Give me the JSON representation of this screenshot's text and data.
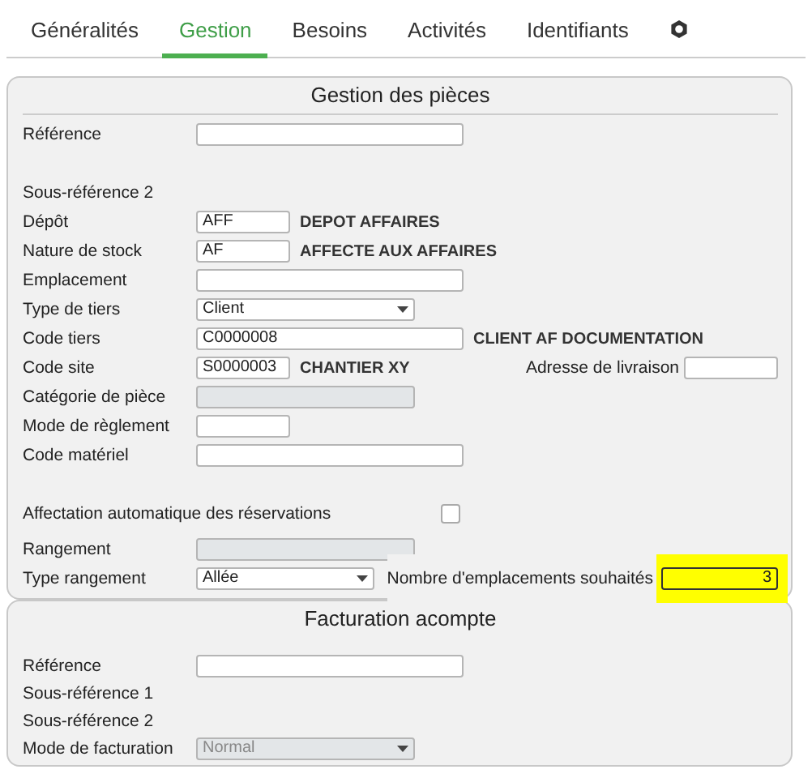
{
  "tabs": [
    {
      "label": "Généralités",
      "selected": false
    },
    {
      "label": "Gestion",
      "selected": true
    },
    {
      "label": "Besoins",
      "selected": false
    },
    {
      "label": "Activités",
      "selected": false
    },
    {
      "label": "Identifiants",
      "selected": false
    }
  ],
  "sections": [
    {
      "title": "Gestion des pièces",
      "groups": [
        [
          {
            "label": "Référence",
            "field": {
              "kind": "text",
              "disabled": false
            }
          }
        ],
        [
          {
            "label": "Sous-référence 2"
          },
          {
            "label": "Dépôt",
            "field": {
              "kind": "code",
              "value": "AFF",
              "disabled": false
            },
            "note": "DEPOT AFFAIRES"
          },
          {
            "label": "Nature de stock",
            "field": {
              "kind": "code",
              "value": "AF",
              "disabled": false
            },
            "note": "AFFECTE AUX AFFAIRES"
          },
          {
            "label": "Emplacement",
            "field": {
              "kind": "text",
              "disabled": false
            }
          },
          {
            "label": "Type de tiers",
            "field": {
              "kind": "select",
              "value": "Client",
              "disabled": false
            }
          },
          {
            "label": "Code tiers",
            "field": {
              "kind": "text",
              "value": "C0000008",
              "disabled": false
            },
            "note": "CLIENT AF  DOCUMENTATION"
          },
          {
            "label": "Code site",
            "field": {
              "kind": "code",
              "value": "S0000003",
              "disabled": false
            },
            "note": "CHANTIER XY",
            "aside": {
              "label": "Adresse de livraison",
              "field": {
                "kind": "code",
                "disabled": false,
                "highlighted": false
              }
            }
          },
          {
            "label": "Catégorie de pièce",
            "field": {
              "kind": "locked",
              "disabled": true
            }
          },
          {
            "label": "Mode de règlement",
            "field": {
              "kind": "code",
              "disabled": false
            }
          },
          {
            "label": "Code matériel",
            "field": {
              "kind": "text",
              "disabled": false
            }
          }
        ],
        [
          {
            "label": "Affectation automatique des réservations",
            "field": {
              "kind": "checkbox",
              "checked": false,
              "disabled": false
            }
          }
        ],
        [
          {
            "label": "Rangement",
            "field": {
              "kind": "locked",
              "disabled": true
            }
          },
          {
            "label": "Type rangement",
            "field": {
              "kind": "select",
              "value": "Allée",
              "disabled": false
            },
            "aside": {
              "label": "Nombre d'emplacements souhaités",
              "field": {
                "kind": "number",
                "value": "3",
                "disabled": false,
                "highlighted": true
              }
            }
          }
        ]
      ]
    },
    {
      "title": "Facturation acompte",
      "groups": [
        [
          {
            "label": "Référence",
            "field": {
              "kind": "text",
              "disabled": false
            }
          },
          {
            "label": "Sous-référence 1"
          },
          {
            "label": "Sous-référence 2"
          },
          {
            "label": "Mode de facturation",
            "field": {
              "kind": "select",
              "value": "Normal",
              "disabled": true
            }
          }
        ]
      ]
    }
  ]
}
